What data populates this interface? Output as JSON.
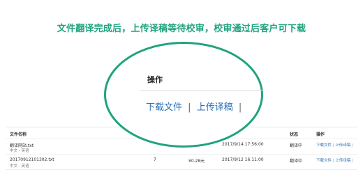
{
  "headline": "文件翻译完成后，上传译稿等待校审，校审通过后客户可下载",
  "table": {
    "headers": {
      "file_name": "文件名称",
      "status": "状态",
      "actions": "操作"
    },
    "rows": [
      {
        "file_name": "翻译网站.txt",
        "languages": "中文 - 英语",
        "time": "2017/9/14 17:56:00",
        "status": "翻译中",
        "download": "下载文件",
        "upload": "上传译稿"
      },
      {
        "file_name": "20170912101302.txt",
        "languages": "中文 - 英语",
        "count": "7",
        "price": "¥0.28元",
        "time": "2017/9/12 16:11:00",
        "status": "翻译中",
        "download": "下载文件",
        "upload": "上传译稿"
      }
    ]
  },
  "panel": {
    "title": "操作",
    "download": "下载文件",
    "upload": "上传译稿"
  }
}
